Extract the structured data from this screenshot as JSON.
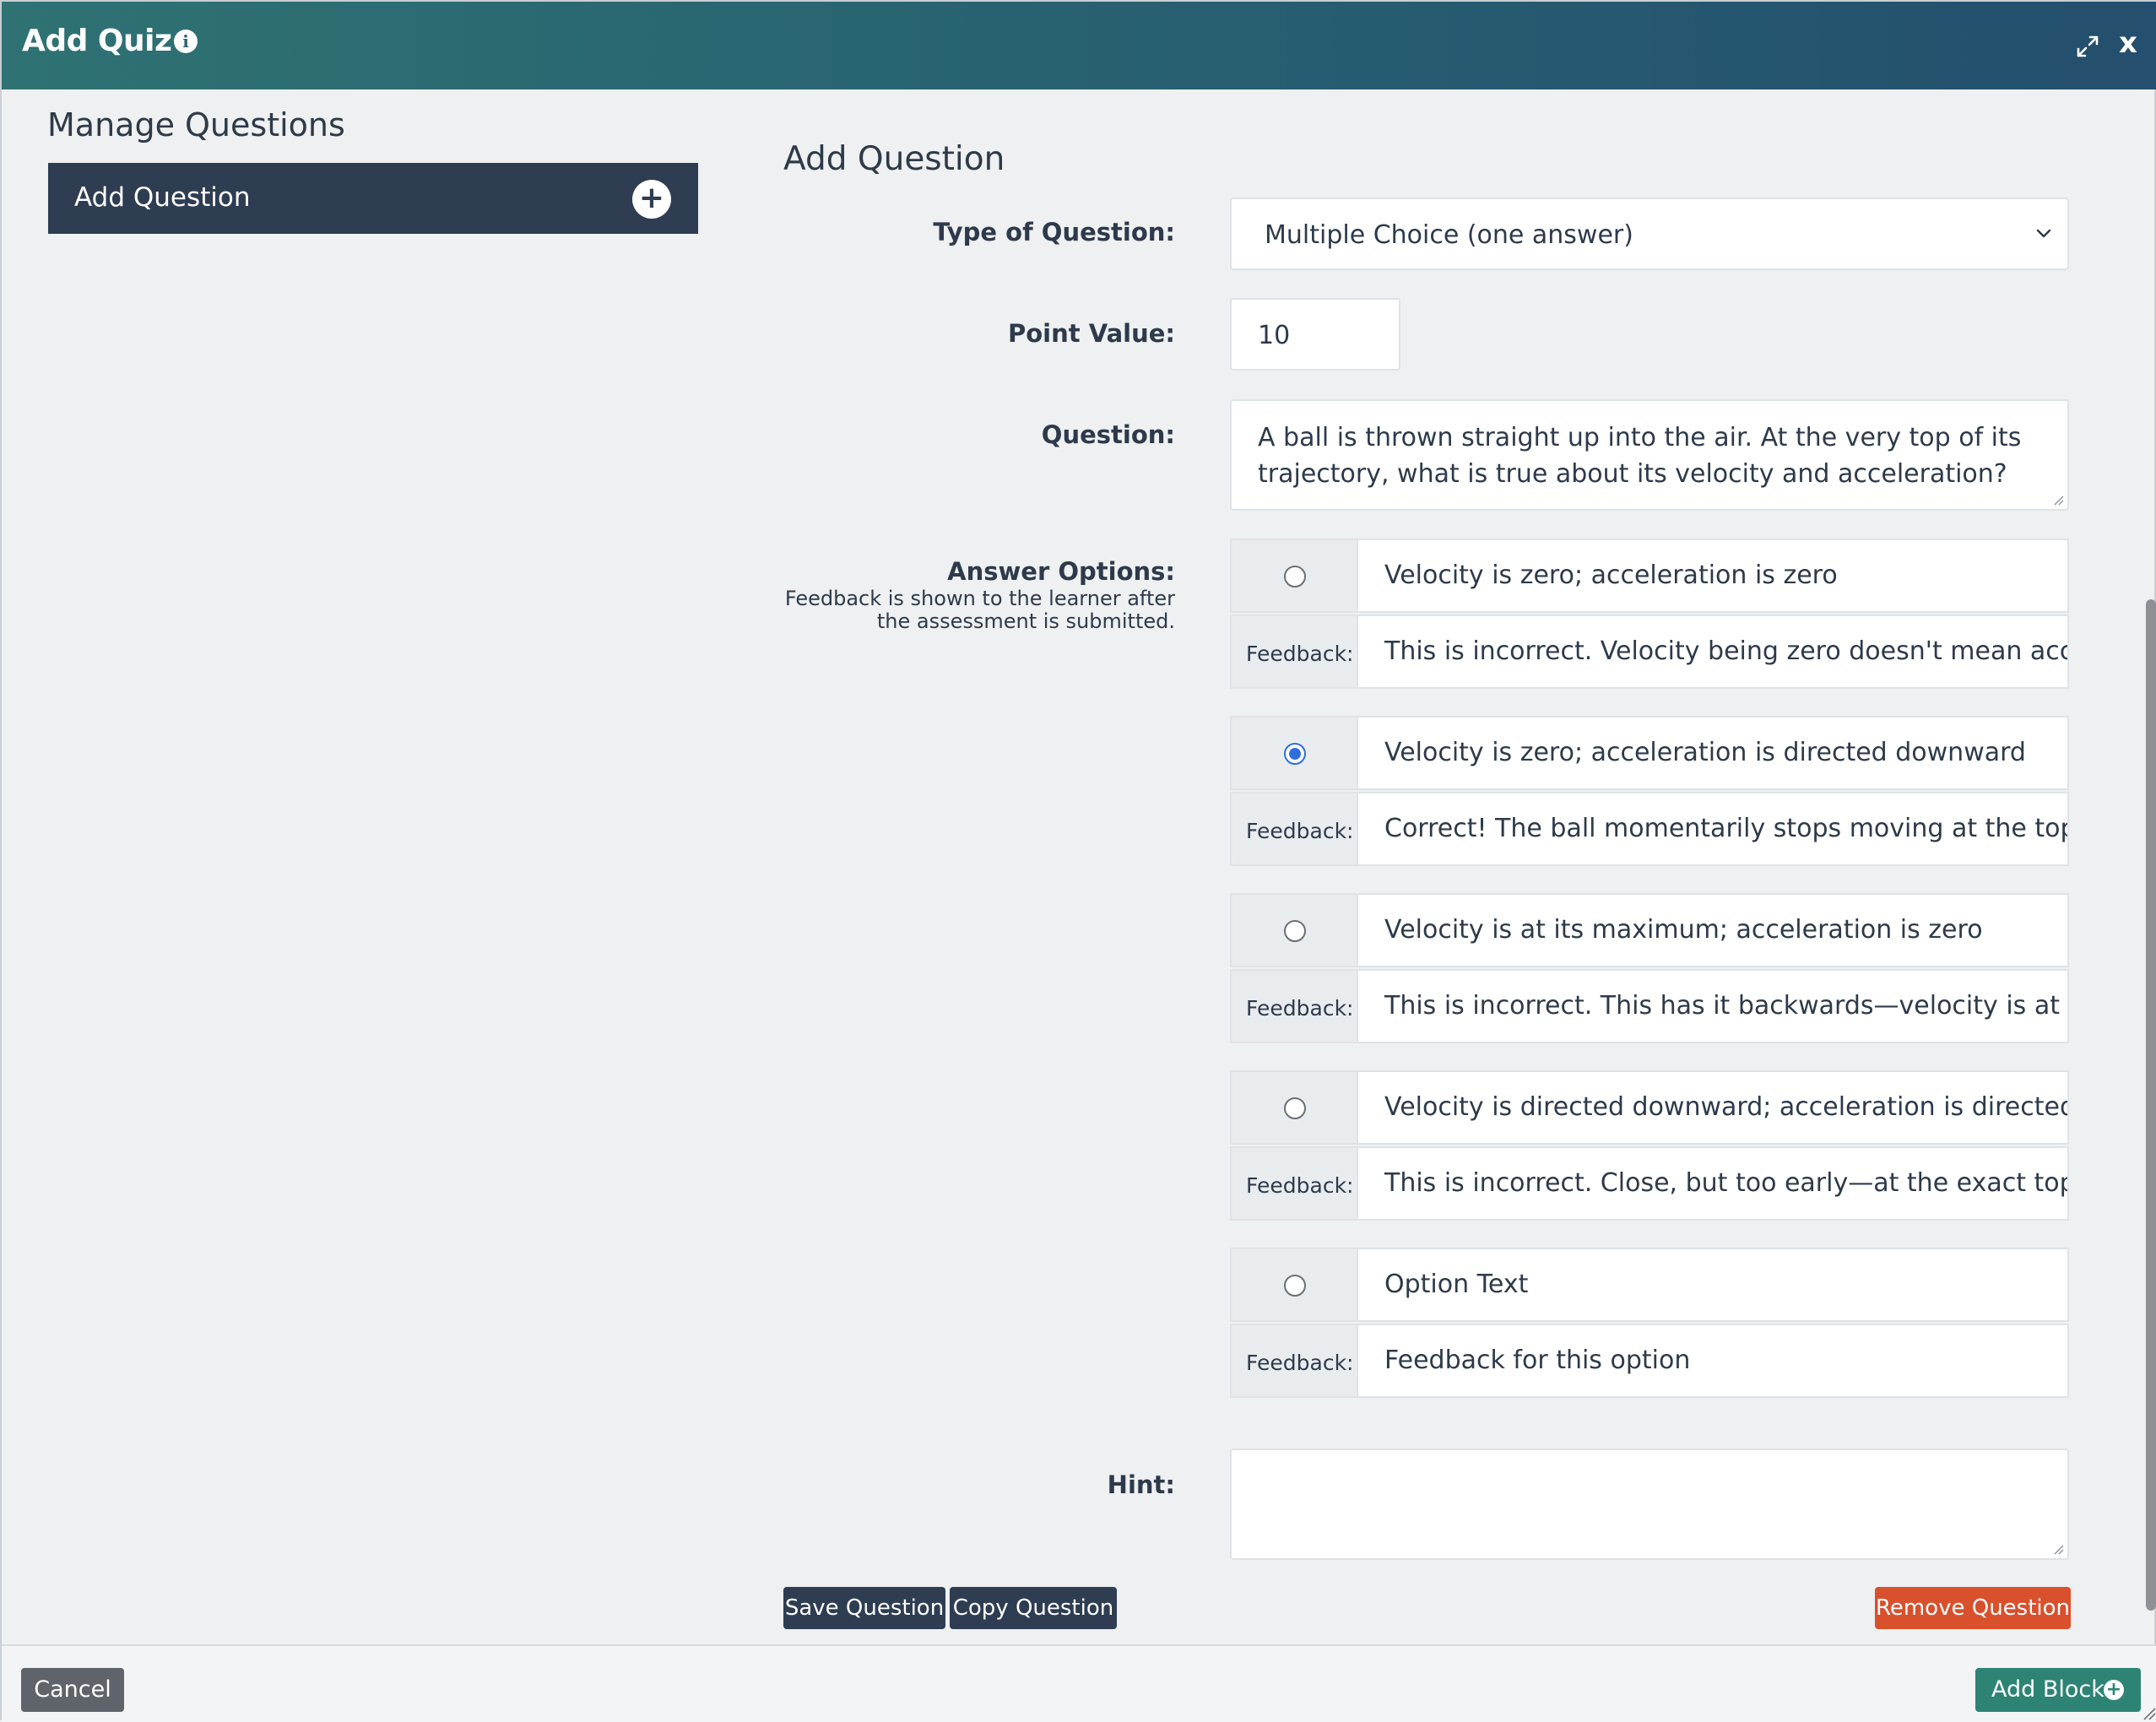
{
  "header": {
    "title": "Add Quiz"
  },
  "sidebar": {
    "title": "Manage Questions",
    "items": [
      {
        "label": "Add Question"
      }
    ]
  },
  "form": {
    "title": "Add Question",
    "type_label": "Type of Question:",
    "type_value": "Multiple Choice (one answer)",
    "point_label": "Point Value:",
    "point_value": "10",
    "question_label": "Question:",
    "question_value": "A ball is thrown straight up into the air. At the very top of its trajectory, what is true about its velocity and acceleration?",
    "answer_label": "Answer Options:",
    "answer_sub_1": "Feedback is shown to the learner after",
    "answer_sub_2": "the assessment is submitted.",
    "feedback_label": "Feedback:",
    "options": [
      {
        "text": "Velocity is zero; acceleration is zero",
        "feedback": "This is incorrect. Velocity being zero doesn't mean accelerati",
        "selected": false
      },
      {
        "text": "Velocity is zero; acceleration is directed downward",
        "feedback": "Correct! The ball momentarily stops moving at the top, but g",
        "selected": true
      },
      {
        "text": "Velocity is at its maximum; acceleration is zero",
        "feedback": "This is incorrect. This has it backwards—velocity is at its min",
        "selected": false
      },
      {
        "text": "Velocity is directed downward; acceleration is directed dowr",
        "feedback": "This is incorrect. Close, but too early—at the exact top, the b",
        "selected": false
      }
    ],
    "new_option_placeholder": "Option Text",
    "new_feedback_placeholder": "Feedback for this option",
    "hint_label": "Hint:",
    "hint_value": ""
  },
  "buttons": {
    "save": "Save Question",
    "copy": "Copy Question",
    "remove": "Remove Question",
    "cancel": "Cancel",
    "add_block": "Add Block"
  },
  "icons": {
    "info": "info-icon",
    "expand": "expand-icon",
    "close": "close-icon",
    "add": "plus-circle-icon",
    "chevron": "chevron-down-icon"
  },
  "colors": {
    "header_start": "#2f7273",
    "header_end": "#244f6e",
    "dark_button": "#2e3d52",
    "remove_button": "#d9502c",
    "add_block_button": "#2e8474",
    "radio_selected": "#2f6fdd"
  }
}
